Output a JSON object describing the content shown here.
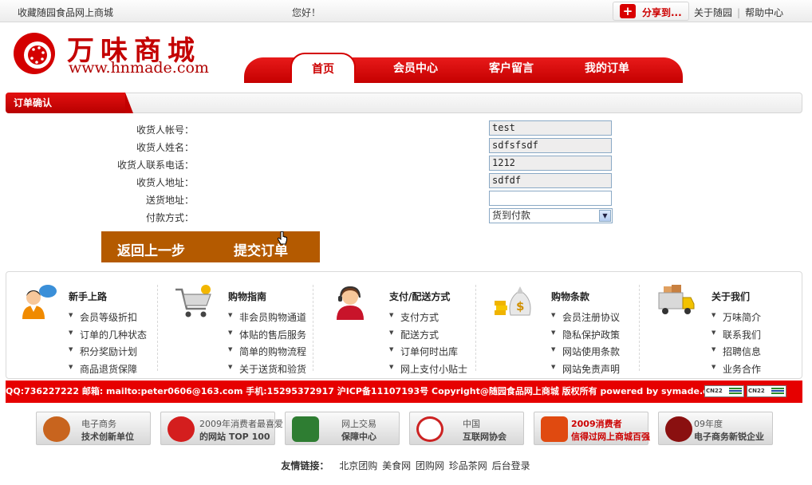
{
  "topbar": {
    "favorite": "收藏随园食品网上商城",
    "hello": "您好！",
    "share": "分享到...",
    "about": "关于随园",
    "help": "帮助中心"
  },
  "logo": {
    "name": "万味商城",
    "url": "www.hnmade.com"
  },
  "nav": [
    "首页",
    "会员中心",
    "客户留言",
    "我的订单"
  ],
  "order": {
    "section_title": "订单确认",
    "fields": [
      {
        "label": "收货人帐号：",
        "value": "test"
      },
      {
        "label": "收货人姓名：",
        "value": "sdfsfsdf"
      },
      {
        "label": "收货人联系电话：",
        "value": "1212"
      },
      {
        "label": "收货人地址：",
        "value": "sdfdf"
      },
      {
        "label": "送货地址：",
        "value": ""
      }
    ],
    "payment_label": "付款方式：",
    "payment_value": "货到付款",
    "back_button": "返回上一步",
    "submit_button": "提交订单"
  },
  "help": [
    {
      "title": "新手上路",
      "icon": "support-person-icon",
      "items": [
        "会员等级折扣",
        "订单的几种状态",
        "积分奖励计划",
        "商品退货保障"
      ]
    },
    {
      "title": "购物指南",
      "icon": "shopping-cart-icon",
      "items": [
        "非会员购物通道",
        "体贴的售后服务",
        "简单的购物流程",
        "关于送货和验货"
      ]
    },
    {
      "title": "支付/配送方式",
      "icon": "headset-agent-icon",
      "items": [
        "支付方式",
        "配送方式",
        "订单何时出库",
        "网上支付小贴士"
      ]
    },
    {
      "title": "购物条款",
      "icon": "money-bag-icon",
      "items": [
        "会员注册协议",
        "隐私保护政策",
        "网站使用条款",
        "网站免责声明"
      ]
    },
    {
      "title": "关于我们",
      "icon": "delivery-truck-icon",
      "items": [
        "万味简介",
        "联系我们",
        "招聘信息",
        "业务合作"
      ]
    }
  ],
  "footer_strip": "QQ:736227222 邮箱: mailto:peter0606@163.com 手机:15295372917 沪ICP备11107193号 Copyright@随园食品网上商城 版权所有 powered by symade.com",
  "mini_badge": "CN22",
  "badges": [
    {
      "l1": "电子商务",
      "l2": "技术创新单位",
      "color": "#c8641e"
    },
    {
      "l1": "2009年消费者最喜爱",
      "l2": "的网站 TOP 100",
      "color": "#d41e1e"
    },
    {
      "l1": "网上交易",
      "l2": "保障中心",
      "color": "#2e7d32"
    },
    {
      "l1": "中国",
      "l2": "互联网协会",
      "color": "#cc2222"
    },
    {
      "l1": "2009消费者",
      "l2": "信得过网上商城百强",
      "color": "#e04a10"
    },
    {
      "l1": "09年度",
      "l2": "电子商务新锐企业",
      "color": "#8a1010"
    }
  ],
  "friends": {
    "label": "友情链接：",
    "links": [
      "北京团购",
      "美食网",
      "团购网",
      "珍品茶网",
      "后台登录"
    ]
  }
}
